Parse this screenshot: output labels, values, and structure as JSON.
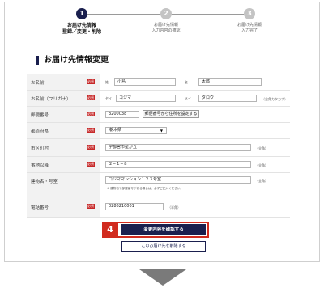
{
  "steps": [
    {
      "num": "1",
      "label": "お届け先情報\n登録／変更・削除"
    },
    {
      "num": "2",
      "label": "お届け先情報\n入力内容の確認"
    },
    {
      "num": "3",
      "label": "お届け先情報\n入力完了"
    }
  ],
  "section_title": "お届け先情報変更",
  "required_badge": "必須",
  "fields": {
    "name": {
      "label": "お名前",
      "sei_prefix": "姓",
      "sei_value": "小島",
      "mei_prefix": "名",
      "mei_value": "太郎"
    },
    "kana": {
      "label": "お名前（フリガナ）",
      "sei_prefix": "セイ",
      "sei_value": "コジマ",
      "mei_prefix": "メイ",
      "mei_value": "タロウ",
      "note": "（全角カタカナ）"
    },
    "zip": {
      "label": "郵便番号",
      "value": "3200038",
      "button": "郵便番号から住所を設定する"
    },
    "pref": {
      "label": "都道府県",
      "value": "栃木県",
      "arrow": "▼"
    },
    "city": {
      "label": "市区町村",
      "value": "宇都宮市星が丘",
      "note": "（全角）"
    },
    "addr": {
      "label": "番地以降",
      "value": "２−１−８",
      "note": "（全角）"
    },
    "bldg": {
      "label": "建物名・号室",
      "value": "コジママンション１２３号室",
      "note": "（全角）",
      "hint": "※ 建物名や部屋番号がある場合は、必ずご記入ください。"
    },
    "tel": {
      "label": "電話番号",
      "value": "0286210001",
      "note": "（半角）"
    }
  },
  "callout_number": "4",
  "confirm_button": "変更内容を確認する",
  "delete_button": "このお届け先を削除する"
}
